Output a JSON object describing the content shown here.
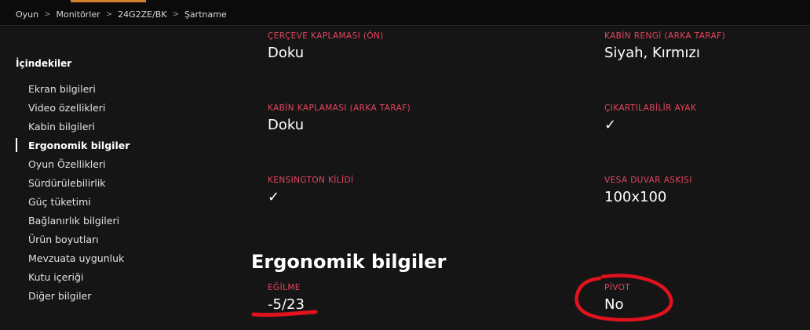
{
  "breadcrumb": {
    "items": [
      "Oyun",
      "Monitörler",
      "24G2ZE/BK",
      "Şartname"
    ],
    "separator": ">"
  },
  "toc": {
    "title": "İçindekiler",
    "items": [
      {
        "label": "Ekran bilgileri",
        "active": false
      },
      {
        "label": "Video özellikleri",
        "active": false
      },
      {
        "label": "Kabin bilgileri",
        "active": false
      },
      {
        "label": "Ergonomik bilgiler",
        "active": true
      },
      {
        "label": "Oyun Özellikleri",
        "active": false
      },
      {
        "label": "Sürdürülebilirlik",
        "active": false
      },
      {
        "label": "Güç tüketimi",
        "active": false
      },
      {
        "label": "Bağlanırlık bilgileri",
        "active": false
      },
      {
        "label": "Ürün boyutları",
        "active": false
      },
      {
        "label": "Mevzuata uygunluk",
        "active": false
      },
      {
        "label": "Kutu içeriği",
        "active": false
      },
      {
        "label": "Diğer bilgiler",
        "active": false
      }
    ]
  },
  "cabinet_specs": [
    {
      "label": "ÇERÇEVE KAPLAMASI (ÖN)",
      "value": "Doku"
    },
    {
      "label": "KABİN RENGİ (ARKA TARAF)",
      "value": "Siyah, Kırmızı"
    },
    {
      "label": "KABİN KAPLAMASI (ARKA TARAF)",
      "value": "Doku"
    },
    {
      "label": "ÇIKARTILABİLİR AYAK",
      "value": "✓"
    },
    {
      "label": "KENSINGTON KİLİDİ",
      "value": "✓"
    },
    {
      "label": "VESA DUVAR ASKISI",
      "value": "100x100"
    }
  ],
  "ergonomics": {
    "title": "Ergonomik bilgiler",
    "specs": [
      {
        "label": "EĞİLME",
        "value": "-5/23"
      },
      {
        "label": "PİVOT",
        "value": "No"
      }
    ]
  },
  "colors": {
    "background": "#151515",
    "topbar": "#0b0b0b",
    "accent_label": "#e2455f",
    "annotation": "#e0121e",
    "tab_accent": "#d2822a"
  }
}
